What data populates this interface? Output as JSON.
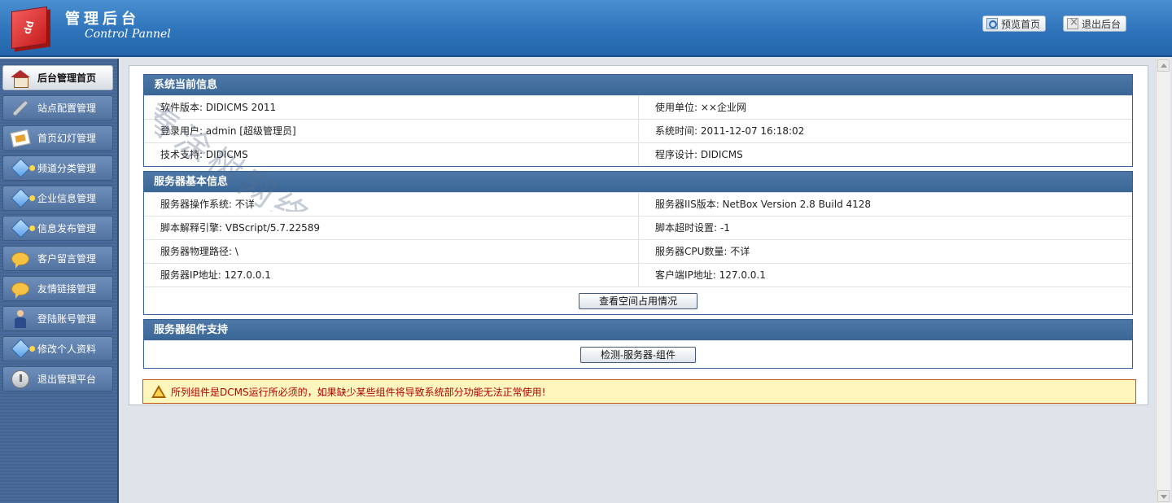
{
  "header": {
    "title": "管理后台",
    "subtitle": "Control Pannel",
    "logo_text": "dd",
    "preview_label": "预览首页",
    "logout_label": "退出后台"
  },
  "sidebar": {
    "items": [
      {
        "label": "后台管理首页",
        "icon": "house-icon",
        "active": true
      },
      {
        "label": "站点配置管理",
        "icon": "wrench-icon"
      },
      {
        "label": "首页幻灯管理",
        "icon": "slides-icon"
      },
      {
        "label": "频道分类管理",
        "icon": "diamond-icon"
      },
      {
        "label": "企业信息管理",
        "icon": "diamond-icon"
      },
      {
        "label": "信息发布管理",
        "icon": "diamond-icon"
      },
      {
        "label": "客户留言管理",
        "icon": "chat-bubble-icon"
      },
      {
        "label": "友情链接管理",
        "icon": "chat-bubble-icon"
      },
      {
        "label": "登陆账号管理",
        "icon": "user-icon"
      },
      {
        "label": "修改个人资料",
        "icon": "diamond-icon"
      },
      {
        "label": "退出管理平台",
        "icon": "power-icon"
      }
    ]
  },
  "system_info": {
    "title": "系统当前信息",
    "rows": [
      [
        "软件版本: DIDICMS 2011",
        "使用单位: ××企业网"
      ],
      [
        "登录用户: admin [超级管理员]",
        "系统时间: 2011-12-07 16:18:02"
      ],
      [
        "技术支持: DIDICMS",
        "程序设计: DIDICMS"
      ]
    ]
  },
  "server_info": {
    "title": "服务器基本信息",
    "rows": [
      [
        "服务器操作系统: 不详",
        "服务器IIS版本: NetBox Version 2.8 Build 4128"
      ],
      [
        "脚本解释引擎: VBScript/5.7.22589",
        "脚本超时设置: -1"
      ],
      [
        "服务器物理路径: \\",
        "服务器CPU数量: 不详"
      ],
      [
        "服务器IP地址: 127.0.0.1",
        "客户端IP地址: 127.0.0.1"
      ]
    ],
    "button_label": "查看空间占用情况"
  },
  "components": {
    "title": "服务器组件支持",
    "button_label": "检测-服务器-组件"
  },
  "warning": {
    "text": "所列组件是DCMS运行所必须的，如果缺少某些组件将导致系统部分功能无法正常使用!"
  },
  "watermark": "春涂树网络"
}
